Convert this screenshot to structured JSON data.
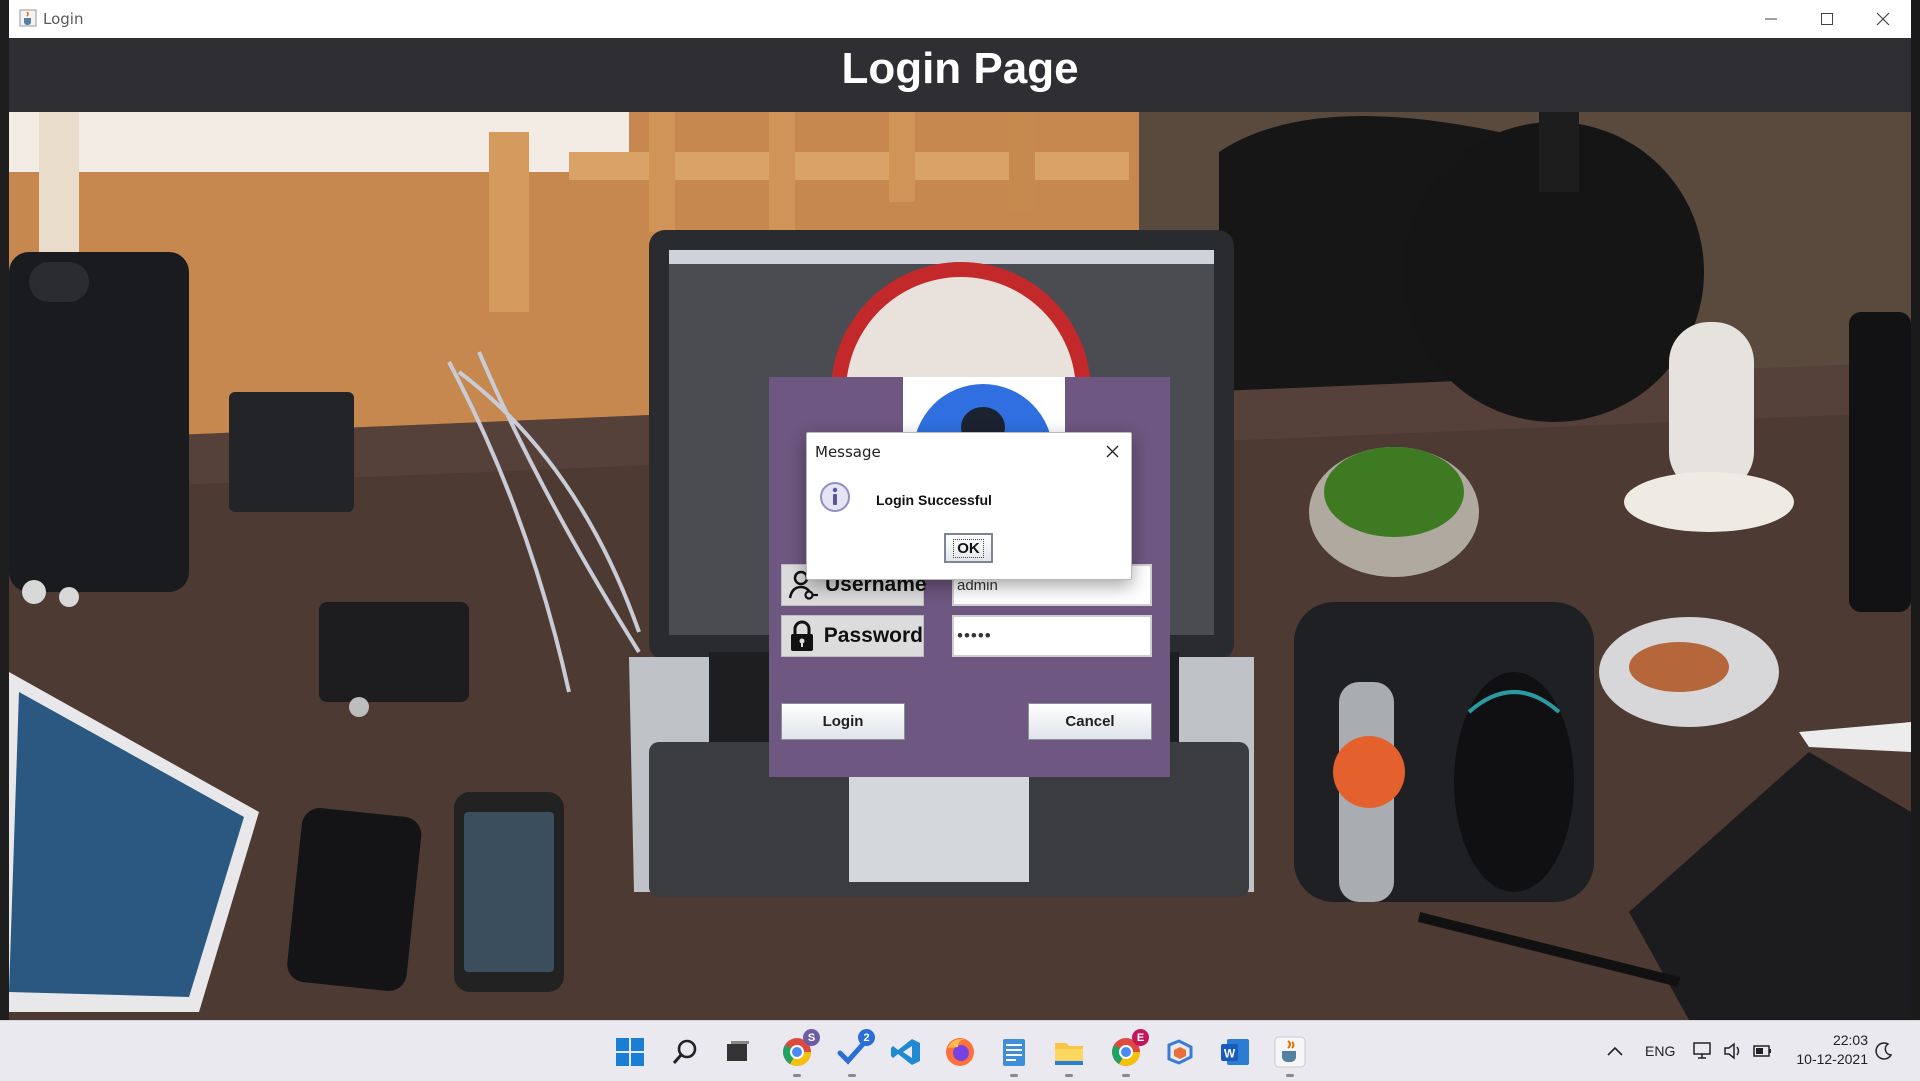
{
  "window": {
    "title": "Login",
    "app_icon": "java-cup-icon",
    "controls": [
      "minimize-icon",
      "maximize-icon",
      "close-icon"
    ]
  },
  "header": {
    "title": "Login Page"
  },
  "login_form": {
    "username_label": "Username",
    "username_icon": "user-key-icon",
    "username_value": "admin",
    "password_label": "Password",
    "password_icon": "lock-icon",
    "password_value": "•••••",
    "login_button": "Login",
    "cancel_button": "Cancel"
  },
  "dialog": {
    "title": "Message",
    "message": "Login Successful",
    "icon": "info-icon",
    "ok_button": "OK"
  },
  "taskbar": {
    "icons": [
      "windows-start-icon",
      "search-icon",
      "task-view-icon",
      "chrome-profile-icon",
      "todo-icon",
      "vscode-icon",
      "firefox-icon",
      "notepad-icon",
      "file-explorer-icon",
      "chrome-icon",
      "copilot-icon",
      "word-icon",
      "java-icon"
    ],
    "badges": {
      "chrome_profile": "S",
      "todo": "2",
      "chrome": "E"
    },
    "language": "ENG",
    "time": "22:03",
    "date": "10-12-2021"
  },
  "colors": {
    "header_bg": "#2f2e33",
    "panel_bg": "#6e5780",
    "taskbar_bg": "#ebe9f0"
  }
}
